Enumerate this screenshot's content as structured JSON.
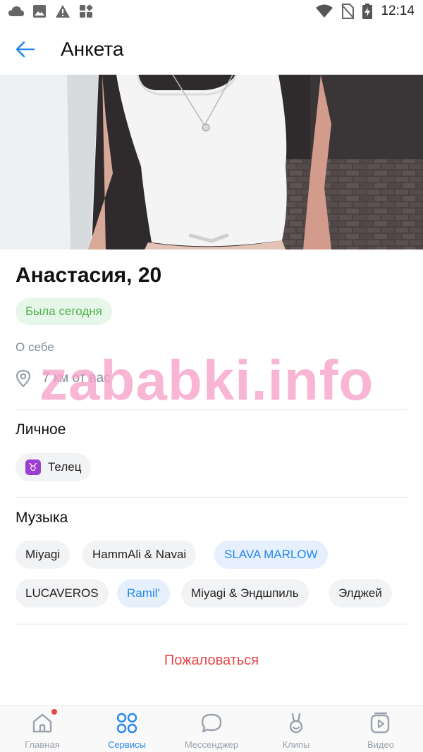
{
  "status_bar": {
    "time": "12:14"
  },
  "app_bar": {
    "title": "Анкета"
  },
  "profile": {
    "name": "Анастасия, 20",
    "online_status": "Была сегодня",
    "about_label": "О себе",
    "distance": "7 км от вас"
  },
  "watermark": "zababki.info",
  "personal": {
    "title": "Личное",
    "zodiac_symbol": "♉",
    "zodiac_label": "Телец"
  },
  "music": {
    "title": "Музыка",
    "tags": [
      {
        "label": "Miyagi",
        "accent": false
      },
      {
        "label": "HammAli & Navai",
        "accent": false
      },
      {
        "label": "SLAVA MARLOW",
        "accent": true
      },
      {
        "label": "LUCAVEROS",
        "accent": false
      },
      {
        "label": "Ramil'",
        "accent": true
      },
      {
        "label": "Miyagi & Эндшпиль",
        "accent": false
      },
      {
        "label": "Элджей",
        "accent": false
      }
    ]
  },
  "report_label": "Пожаловаться",
  "tab_bar": {
    "tabs": [
      {
        "label": "Главная",
        "icon": "home-icon",
        "active": false,
        "badge": true
      },
      {
        "label": "Сервисы",
        "icon": "services-icon",
        "active": true,
        "badge": false
      },
      {
        "label": "Мессенджер",
        "icon": "messenger-icon",
        "active": false,
        "badge": false
      },
      {
        "label": "Клипы",
        "icon": "clips-icon",
        "active": false,
        "badge": false
      },
      {
        "label": "Видео",
        "icon": "video-icon",
        "active": false,
        "badge": false
      }
    ]
  },
  "colors": {
    "accent": "#2688eb",
    "online_green": "#4bb34b",
    "report_red": "#e64646",
    "secondary_text": "#818c99"
  }
}
